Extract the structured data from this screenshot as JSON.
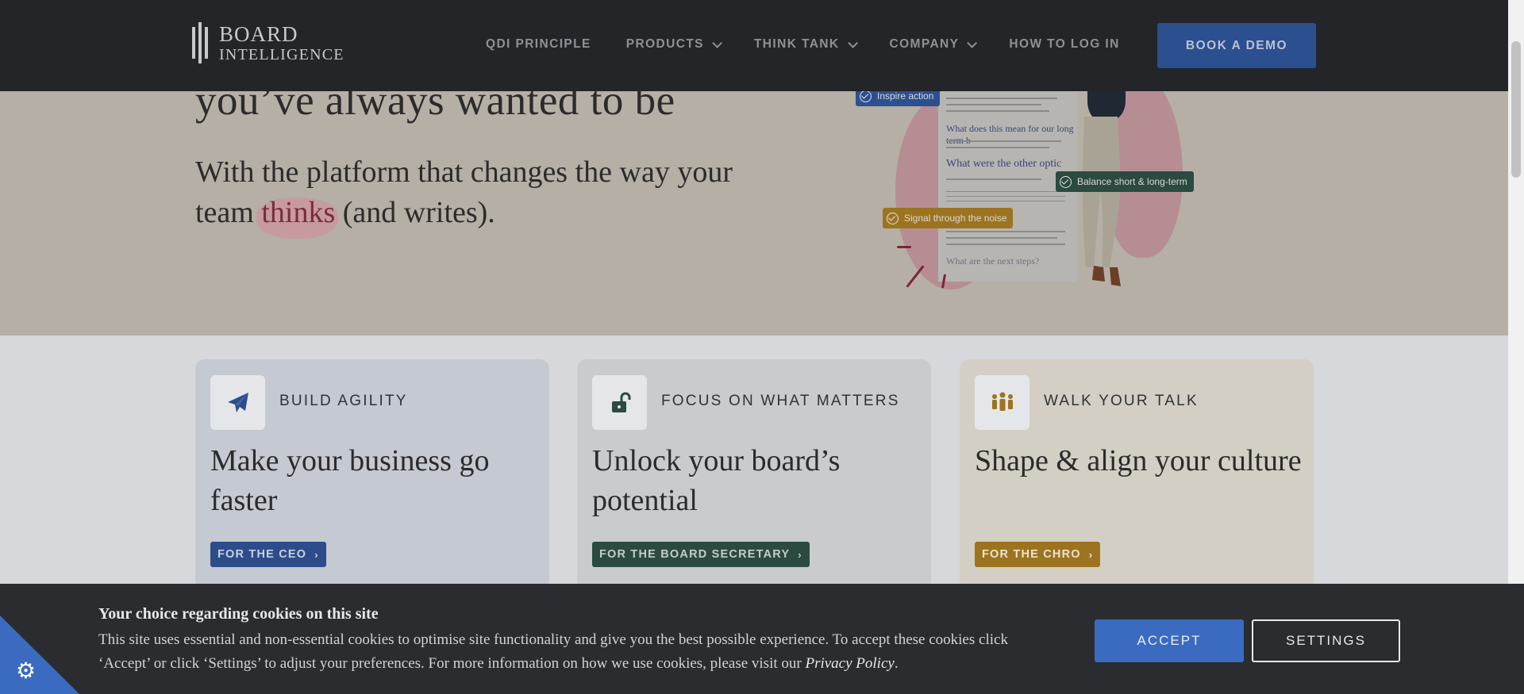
{
  "header": {
    "logo_line1": "BOARD",
    "logo_line2": "INTELLIGENCE",
    "nav": [
      {
        "label": "QDI PRINCIPLE"
      },
      {
        "label": "PRODUCTS"
      },
      {
        "label": "THINK TANK"
      },
      {
        "label": "COMPANY"
      },
      {
        "label": "HOW TO LOG IN"
      }
    ],
    "cta": "BOOK A DEMO"
  },
  "hero": {
    "title": "you’ve always wanted to be",
    "sub_before": "With the platform that changes the way your team ",
    "sub_highlight": "thinks",
    "sub_after": " (and writes).",
    "tags": [
      "Inspire action",
      "Balance short & long-term",
      "Signal through the noise"
    ],
    "doc_headings": [
      "What does this mean for our long term b",
      "What were the other optic",
      "What are the next steps?"
    ]
  },
  "cards": [
    {
      "eyebrow": "BUILD AGILITY",
      "headline": "Make your business go faster",
      "cta": "FOR THE CEO",
      "icon": "paper-plane-icon",
      "bg": "#c5c9d1",
      "cta_bg": "#2d4d8a",
      "cta_color": "#c8d0e0"
    },
    {
      "eyebrow": "FOCUS ON WHAT MATTERS",
      "headline": "Unlock your board’s potential",
      "cta": "FOR THE BOARD SECRETARY",
      "icon": "unlock-icon",
      "bg": "#c9cbcd",
      "cta_bg": "#2b4a40",
      "cta_color": "#c3cdc9"
    },
    {
      "eyebrow": "WALK YOUR TALK",
      "headline": "Shape & align your culture",
      "cta": "FOR THE CHRO",
      "icon": "people-icon",
      "bg": "#d3cfc4",
      "cta_bg": "#9c7420",
      "cta_color": "#ece3cf"
    }
  ],
  "cookie": {
    "title": "Your choice regarding cookies on this site",
    "text_before": "This site uses essential and non-essential cookies to optimise site functionality and give you the best possible experience. To accept these cookies click ‘Accept’ or click ‘Settings’ to adjust your preferences. For more information on how we use cookies, please visit our ",
    "policy_link": "Privacy Policy",
    "text_after": ".",
    "accept": "ACCEPT",
    "settings": "SETTINGS"
  }
}
